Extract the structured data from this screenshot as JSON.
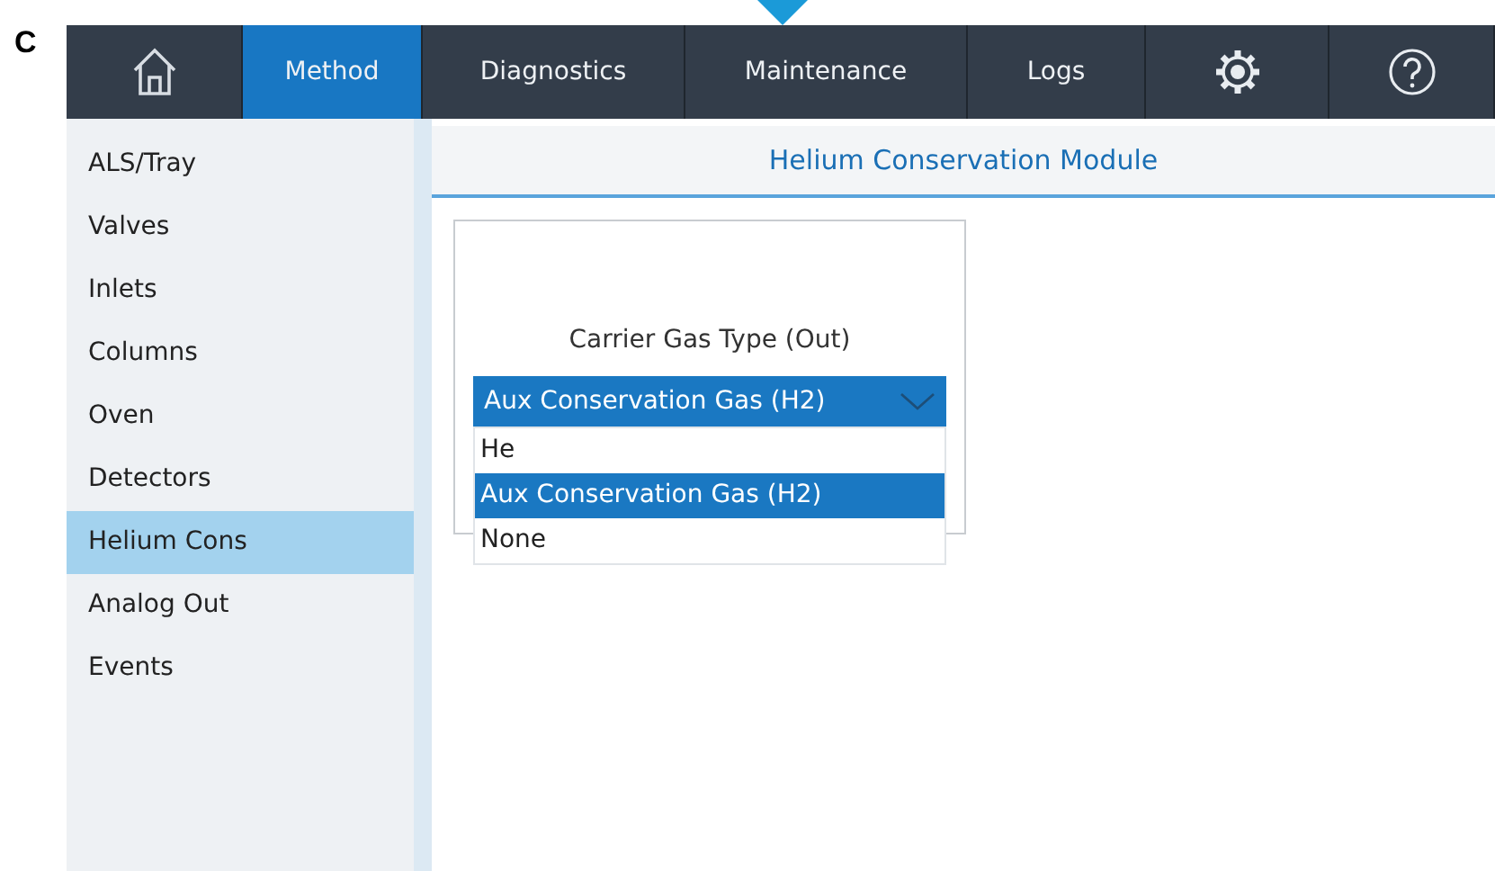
{
  "panel_label": "C",
  "tabs": [
    {
      "kind": "home",
      "selected": false
    },
    {
      "kind": "text",
      "label": "Method",
      "selected": true
    },
    {
      "kind": "text",
      "label": "Diagnostics",
      "selected": false
    },
    {
      "kind": "text",
      "label": "Maintenance",
      "selected": false
    },
    {
      "kind": "text",
      "label": "Logs",
      "selected": false
    },
    {
      "kind": "gear",
      "selected": false
    },
    {
      "kind": "help",
      "selected": false
    }
  ],
  "sidebar": {
    "items": [
      {
        "label": "ALS/Tray",
        "selected": false
      },
      {
        "label": "Valves",
        "selected": false
      },
      {
        "label": "Inlets",
        "selected": false
      },
      {
        "label": "Columns",
        "selected": false
      },
      {
        "label": "Oven",
        "selected": false
      },
      {
        "label": "Detectors",
        "selected": false
      },
      {
        "label": "Helium Cons",
        "selected": true
      },
      {
        "label": "Analog Out",
        "selected": false
      },
      {
        "label": "Events",
        "selected": false
      }
    ]
  },
  "section_title": "Helium Conservation Module",
  "field": {
    "label": "Carrier Gas Type (Out)",
    "value": "Aux Conservation Gas (H2)",
    "options": [
      {
        "label": "He",
        "selected": false
      },
      {
        "label": "Aux Conservation Gas (H2)",
        "selected": true
      },
      {
        "label": "None",
        "selected": false
      }
    ]
  }
}
